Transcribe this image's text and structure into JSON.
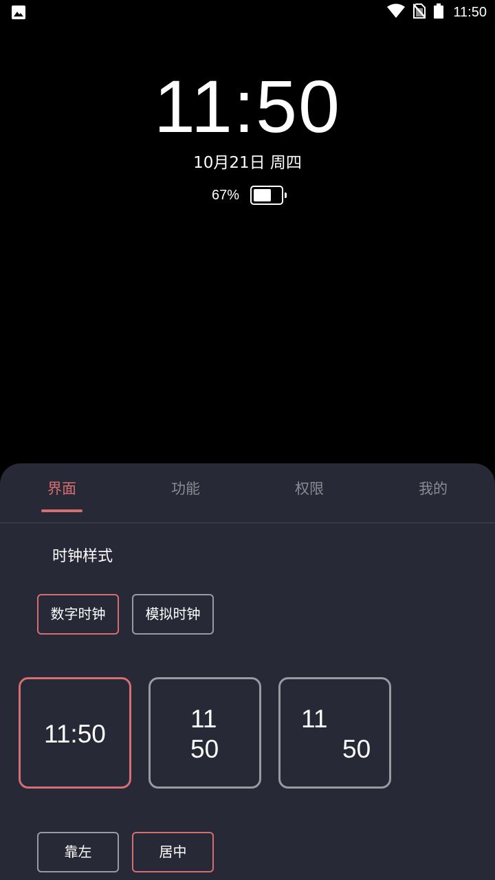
{
  "status_bar": {
    "time": "11:50",
    "icons": [
      "image-notification-icon",
      "wifi-icon",
      "no-sim-icon",
      "battery-icon"
    ]
  },
  "clock": {
    "time": "11:50",
    "date": "10月21日 周四",
    "battery_percent_text": "67%",
    "battery_level": 0.67
  },
  "sheet": {
    "tabs": [
      {
        "label": "界面",
        "active": true
      },
      {
        "label": "功能",
        "active": false
      },
      {
        "label": "权限",
        "active": false
      },
      {
        "label": "我的",
        "active": false
      }
    ],
    "section_title": "时钟样式",
    "clock_type_options": [
      {
        "label": "数字时钟",
        "selected": true
      },
      {
        "label": "模拟时钟",
        "selected": false
      }
    ],
    "style_cards": [
      {
        "text": "11:50",
        "selected": true
      },
      {
        "hours": "11",
        "minutes": "50",
        "selected": false
      },
      {
        "hours": "11",
        "minutes": "50",
        "selected": false
      }
    ],
    "alignment_options": [
      {
        "label": "靠左",
        "selected": false
      },
      {
        "label": "居中",
        "selected": true
      }
    ]
  },
  "colors": {
    "accent": "#d76e72",
    "sheet_background": "#282936",
    "inactive_tab": "#8a8b93",
    "card_border": "#9a9ba2"
  }
}
